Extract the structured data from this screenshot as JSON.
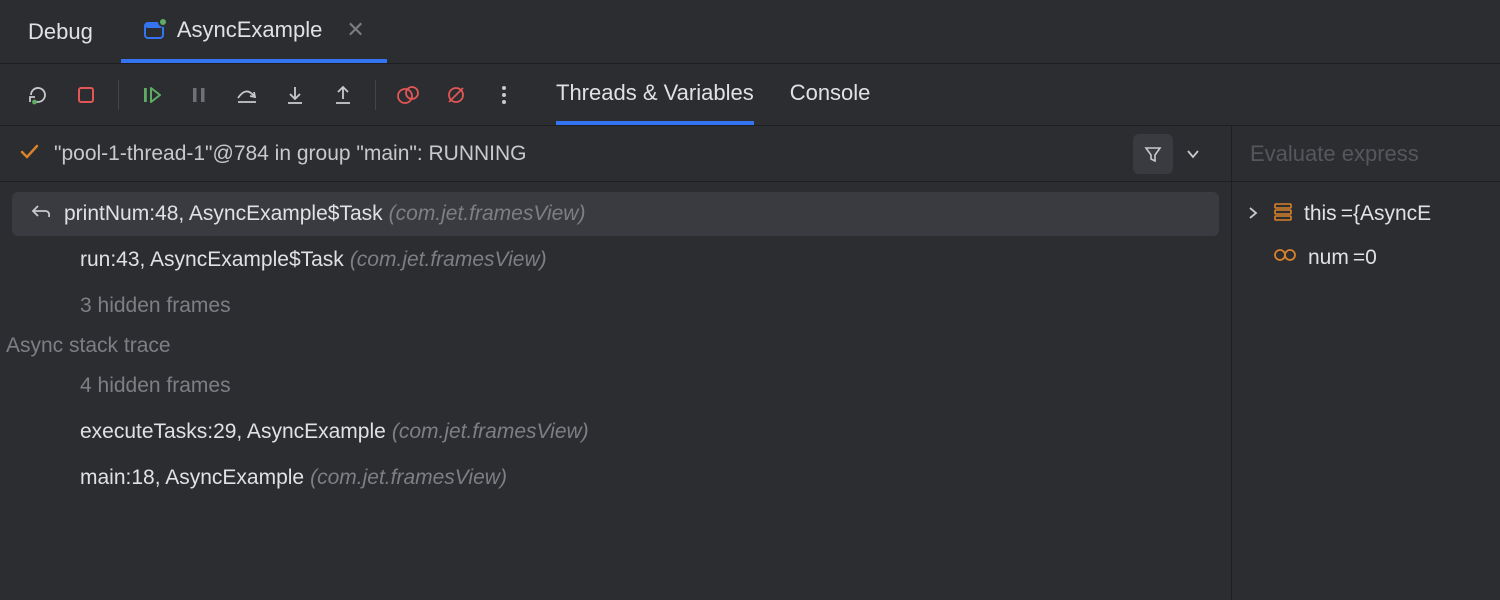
{
  "header": {
    "title": "Debug",
    "runTab": {
      "label": "AsyncExample",
      "closeTooltip": "Close"
    }
  },
  "toolbar": {
    "rerun": "Rerun",
    "stop": "Stop",
    "resume": "Resume",
    "pause": "Pause",
    "stepOver": "Step Over",
    "stepInto": "Step Into",
    "stepOut": "Step Out",
    "viewBreakpoints": "View Breakpoints",
    "muteBreakpoints": "Mute Breakpoints",
    "more": "More"
  },
  "innerTabs": {
    "threads": "Threads & Variables",
    "console": "Console"
  },
  "thread": {
    "label": "\"pool-1-thread-1\"@784 in group \"main\": RUNNING"
  },
  "frames": [
    {
      "selected": true,
      "hasUndo": true,
      "method": "printNum:48, AsyncExample$Task",
      "pkg": "(com.jet.framesView)"
    },
    {
      "selected": false,
      "hasUndo": false,
      "method": "run:43, AsyncExample$Task",
      "pkg": "(com.jet.framesView)"
    }
  ],
  "hiddenFrames1": "3 hidden frames",
  "asyncLabel": "Async stack trace",
  "hiddenFrames2": "4 hidden frames",
  "asyncFrames": [
    {
      "method": "executeTasks:29, AsyncExample",
      "pkg": "(com.jet.framesView)"
    },
    {
      "method": "main:18, AsyncExample",
      "pkg": "(com.jet.framesView)"
    }
  ],
  "evalPlaceholder": "Evaluate express",
  "variables": [
    {
      "expandable": true,
      "iconColor": "#d9822b",
      "name": "this",
      "eq": " = ",
      "value": "{AsyncE"
    },
    {
      "expandable": false,
      "iconColor": "#d9822b",
      "name": "num",
      "eq": " = ",
      "value": "0"
    }
  ]
}
